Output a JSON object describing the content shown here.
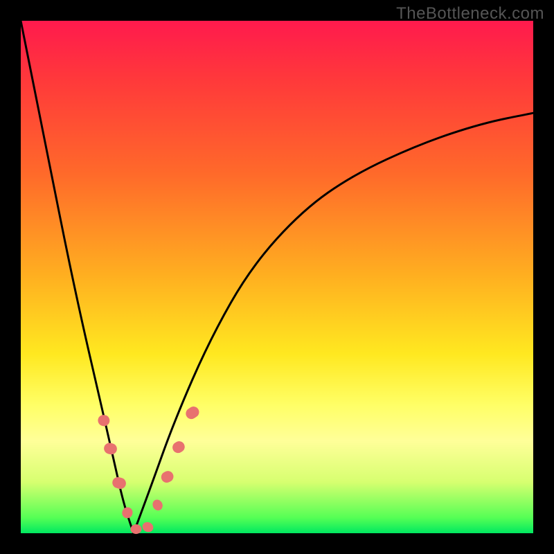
{
  "watermark": "TheBottleneck.com",
  "chart_data": {
    "type": "line",
    "title": "",
    "xlabel": "",
    "ylabel": "",
    "xlim": [
      0,
      100
    ],
    "ylim": [
      0,
      100
    ],
    "note": "V-shaped bottleneck curve on red→yellow→green gradient background; minimum near x≈22",
    "series": [
      {
        "name": "left-branch",
        "x": [
          0,
          3,
          6,
          9,
          12,
          15,
          18,
          20,
          22
        ],
        "y": [
          100,
          85,
          70,
          55,
          41,
          28,
          15,
          6,
          0
        ]
      },
      {
        "name": "right-branch",
        "x": [
          22,
          25,
          30,
          37,
          45,
          55,
          65,
          78,
          90,
          100
        ],
        "y": [
          0,
          8,
          22,
          38,
          52,
          63,
          70,
          76,
          80,
          82
        ]
      }
    ],
    "beads": {
      "name": "highlighted-segment",
      "points": [
        {
          "x": 16.2,
          "y": 22.0,
          "len": 3.6,
          "ang": -76
        },
        {
          "x": 17.5,
          "y": 16.5,
          "len": 4.0,
          "ang": -76
        },
        {
          "x": 19.2,
          "y": 9.8,
          "len": 4.2,
          "ang": -74
        },
        {
          "x": 20.8,
          "y": 4.0,
          "len": 3.2,
          "ang": -68
        },
        {
          "x": 22.5,
          "y": 0.8,
          "len": 2.6,
          "ang": 0
        },
        {
          "x": 24.8,
          "y": 1.2,
          "len": 2.6,
          "ang": 25
        },
        {
          "x": 26.7,
          "y": 5.5,
          "len": 2.5,
          "ang": 65
        },
        {
          "x": 28.6,
          "y": 11.0,
          "len": 3.8,
          "ang": 63
        },
        {
          "x": 30.8,
          "y": 16.8,
          "len": 3.8,
          "ang": 60
        },
        {
          "x": 33.5,
          "y": 23.5,
          "len": 4.2,
          "ang": 56
        }
      ]
    },
    "gradient_stops": [
      {
        "pos": 0,
        "color": "#ff1a4d"
      },
      {
        "pos": 50,
        "color": "#ffd020"
      },
      {
        "pos": 80,
        "color": "#ffff80"
      },
      {
        "pos": 100,
        "color": "#00e860"
      }
    ]
  }
}
